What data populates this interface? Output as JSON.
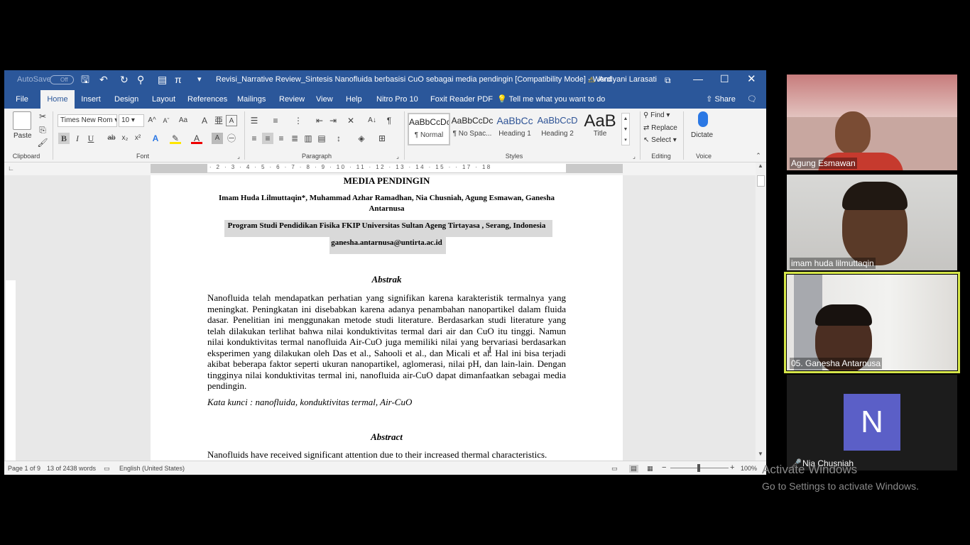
{
  "word": {
    "autosave_label": "AutoSave",
    "autosave_state": "Off",
    "title": "Revisi_Narrative Review_Sintesis Nanofluida berbasisi CuO sebagai media pendingin [Compatibility Mode]  -  Word",
    "user": "Andyani Larasati",
    "tabs": [
      "File",
      "Home",
      "Insert",
      "Design",
      "Layout",
      "References",
      "Mailings",
      "Review",
      "View",
      "Help",
      "Nitro Pro 10",
      "Foxit Reader PDF"
    ],
    "tell_me": "Tell me what you want to do",
    "share": "Share",
    "ribbon": {
      "paste": "Paste",
      "clipboard": "Clipboard",
      "font_name": "Times New Rom",
      "font_size": "10",
      "font": "Font",
      "paragraph": "Paragraph",
      "styles_label": "Styles",
      "styles": [
        {
          "preview": "AaBbCcDc",
          "name": "¶ Normal"
        },
        {
          "preview": "AaBbCcDc",
          "name": "¶ No Spac..."
        },
        {
          "preview": "AaBbCc",
          "name": "Heading 1"
        },
        {
          "preview": "AaBbCcD",
          "name": "Heading 2"
        },
        {
          "preview": "AaB",
          "name": "Title"
        }
      ],
      "find": "Find",
      "replace": "Replace",
      "select": "Select",
      "editing": "Editing",
      "dictate": "Dictate",
      "voice": "Voice"
    },
    "ruler_text": "· 2 · 1 · · · 1 · 2 · 3 · 4 · 5 · 6 · 7 · 8 · 9 · 10 · 11 · 12 · 13 · 14 · 15 · · 17 · 18",
    "document": {
      "heading": "MEDIA PENDINGIN",
      "authors_line1": "Imam Huda Lilmuttaqin*, Muhammad Azhar Ramadhan, Nia Chusniah, Agung Esmawan, Ganesha",
      "authors_line2": "Antarnusa",
      "affiliation": "Program Studi Pendidikan Fisika FKIP Universitas Sultan Ageng Tirtayasa , Serang, Indonesia",
      "email": "ganesha.antarnusa@untirta.ac.id",
      "abstrak_title": "Abstrak",
      "abstrak_body": "Nanofluida telah mendapatkan perhatian yang signifikan karena karakteristik termalnya yang meningkat. Peningkatan ini disebabkan karena adanya penambahan nanopartikel dalam fluida dasar. Penelitian ini menggunakan metode studi literature. Berdasarkan studi literature yang telah dilakukan terlihat bahwa nilai konduktivitas termal dari air dan CuO itu tinggi. Namun nilai konduktivitas termal nanofluida Air-CuO juga memiliki nilai yang bervariasi berdasarkan eksperimen yang dilakukan oleh Das et al., Sahooli et al., dan Micali et al. Hal ini bisa terjadi akibat beberapa faktor seperti ukuran nanopartikel, aglomerasi, nilai pH, dan lain-lain. Dengan tingginya nilai konduktivitas termal ini, nanofluida air-CuO dapat dimanfaatkan sebagai media pendingin.",
      "keywords": "Kata kunci : nanofluida, konduktivitas termal, Air-CuO",
      "abstract_title": "Abstract",
      "abstract_body": "Nanofluids have received significant attention due to their increased thermal characteristics."
    },
    "status": {
      "page": "Page 1 of 9",
      "words": "13 of 2438 words",
      "language": "English (United States)",
      "zoom": "100%"
    }
  },
  "participants": [
    {
      "name": "Agung Esmawan"
    },
    {
      "name": "imam huda lilmuttaqin"
    },
    {
      "name": "05. Ganesha Antarnusa"
    },
    {
      "name": "Nia Chusniah",
      "initial": "N"
    }
  ],
  "watermark": {
    "line1": "Activate Windows",
    "line2": "Go to Settings to activate Windows."
  }
}
